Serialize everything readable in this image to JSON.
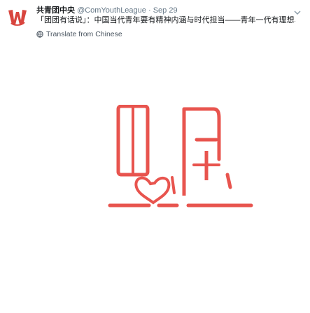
{
  "tweet": {
    "display_name": "共青团中央",
    "handle": "@ComYouthLeague",
    "separator": "·",
    "date": "Sep 29",
    "text": "「团团有话说」：中国当代青年要有精神内涵与时代担当——青年一代有理想、有本领、有担当，国家就有前途，民族就有希望。",
    "translate_label": "Translate from Chinese",
    "avatar_icon": "youth-league-logo",
    "menu_icon": "chevron-down-icon",
    "globe_icon": "globe-icon"
  },
  "colors": {
    "brand_red": "#e8544e",
    "text_primary": "#14171a",
    "text_secondary": "#657786"
  }
}
